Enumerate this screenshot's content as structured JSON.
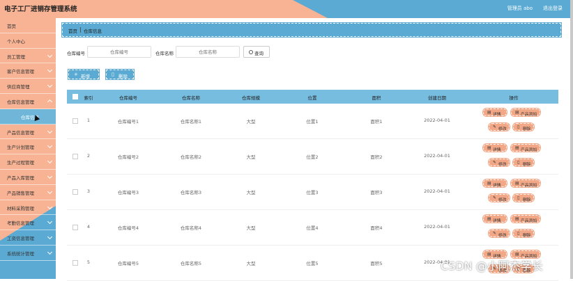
{
  "header": {
    "title": "电子工厂进销存管理系统",
    "user": "管理员 abo",
    "logout": "退出登录"
  },
  "colors": {
    "accent": "#5aaad3",
    "peach": "#f7b394",
    "header_th": "#76bde0",
    "op_button": "#f2a887"
  },
  "sidebar": {
    "items": [
      {
        "label": "首页",
        "expandable": false
      },
      {
        "label": "个人中心",
        "expandable": false
      },
      {
        "label": "员工管理",
        "expandable": true
      },
      {
        "label": "客户信息管理",
        "expandable": true
      },
      {
        "label": "供应商管理",
        "expandable": true
      },
      {
        "label": "仓库信息管理",
        "expandable": true,
        "open": true
      },
      {
        "label": "仓库信息",
        "sub": true
      },
      {
        "label": "产品信息管理",
        "expandable": true
      },
      {
        "label": "生产计划管理",
        "expandable": true
      },
      {
        "label": "生产过程管理",
        "expandable": true
      },
      {
        "label": "产品入库管理",
        "expandable": true
      },
      {
        "label": "产品销售管理",
        "expandable": true
      },
      {
        "label": "材料采购管理",
        "expandable": true
      },
      {
        "label": "考勤信息管理",
        "expandable": true
      },
      {
        "label": "工资信息管理",
        "expandable": true
      },
      {
        "label": "系统统计管理",
        "expandable": true
      }
    ]
  },
  "breadcrumb": {
    "home": "首页",
    "current": "仓库信息"
  },
  "search": {
    "field1_label": "仓库编号",
    "field1_placeholder": "仓库编号",
    "field2_label": "仓库名称",
    "field2_placeholder": "仓库名称",
    "query_label": "查询",
    "query_icon": "search-icon"
  },
  "actions": {
    "add_label": "新增",
    "add_icon": "plus-icon",
    "delete_label": "删除",
    "delete_icon": "trash-icon"
  },
  "table": {
    "columns": [
      "索引",
      "仓库编号",
      "仓库名称",
      "仓库规模",
      "位置",
      "面积",
      "创建日期",
      "操作"
    ],
    "ops": {
      "detail": "详情",
      "product_add": "产品添加",
      "edit": "修改",
      "delete": "删除"
    },
    "rows": [
      {
        "index": "1",
        "code": "仓库编号1",
        "name": "仓库名称1",
        "scale": "大型",
        "location": "位置1",
        "area": "面积1",
        "date": "2022-04-01"
      },
      {
        "index": "2",
        "code": "仓库编号2",
        "name": "仓库名称2",
        "scale": "大型",
        "location": "位置2",
        "area": "面积2",
        "date": "2022-04-01"
      },
      {
        "index": "3",
        "code": "仓库编号3",
        "name": "仓库名称3",
        "scale": "大型",
        "location": "位置3",
        "area": "面积3",
        "date": "2022-04-01"
      },
      {
        "index": "4",
        "code": "仓库编号4",
        "name": "仓库名称4",
        "scale": "大型",
        "location": "位置4",
        "area": "面积4",
        "date": "2022-04-01"
      },
      {
        "index": "5",
        "code": "仓库编号5",
        "name": "仓库名称5",
        "scale": "大型",
        "location": "位置5",
        "area": "面积5",
        "date": "2022-04-01"
      }
    ]
  },
  "watermark": "CSDN @小阿杰学长"
}
